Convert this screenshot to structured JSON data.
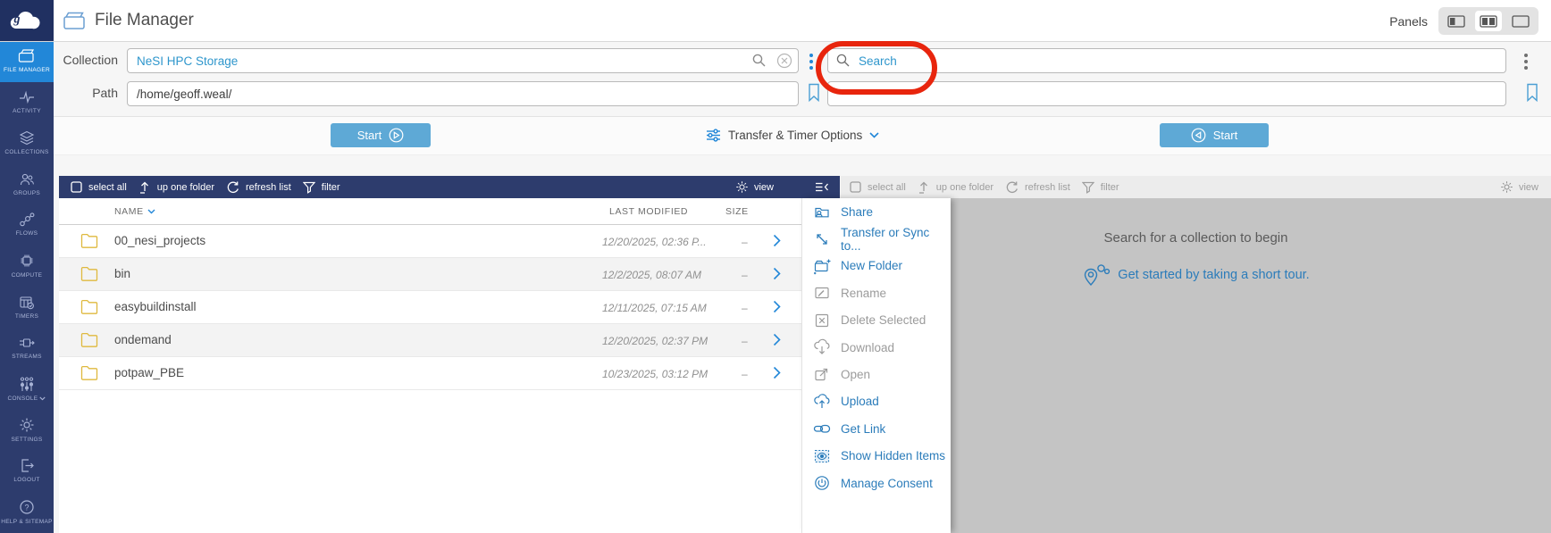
{
  "topbar": {
    "title": "File Manager",
    "panels_label": "Panels"
  },
  "sidebar": {
    "items": [
      {
        "label": "FILE MANAGER"
      },
      {
        "label": "ACTIVITY"
      },
      {
        "label": "COLLECTIONS"
      },
      {
        "label": "GROUPS"
      },
      {
        "label": "FLOWS"
      },
      {
        "label": "COMPUTE"
      },
      {
        "label": "TIMERS"
      },
      {
        "label": "STREAMS"
      },
      {
        "label": "CONSOLE"
      },
      {
        "label": "SETTINGS"
      },
      {
        "label": "LOGOUT"
      },
      {
        "label": "HELP & SITEMAP"
      }
    ]
  },
  "collection_form": {
    "collection_label": "Collection",
    "collection_value": "NeSI HPC Storage",
    "path_label": "Path",
    "path_value": "/home/geoff.weal/",
    "search_placeholder": "Search"
  },
  "transfer_bar": {
    "start_left": "Start",
    "options_label": "Transfer & Timer Options",
    "start_right": "Start"
  },
  "toolbar": {
    "select_all": "select all",
    "up_one_folder": "up one folder",
    "refresh_list": "refresh list",
    "filter": "filter",
    "view": "view"
  },
  "table": {
    "headers": {
      "name": "NAME",
      "last_modified": "LAST MODIFIED",
      "size": "SIZE"
    },
    "rows": [
      {
        "name": "00_nesi_projects",
        "modified": "12/20/2025, 02:36 P...",
        "size": "–"
      },
      {
        "name": "bin",
        "modified": "12/2/2025, 08:07 AM",
        "size": "–"
      },
      {
        "name": "easybuildinstall",
        "modified": "12/11/2025, 07:15 AM",
        "size": "–"
      },
      {
        "name": "ondemand",
        "modified": "12/20/2025, 02:37 PM",
        "size": "–"
      },
      {
        "name": "potpaw_PBE",
        "modified": "10/23/2025, 03:12 PM",
        "size": "–"
      }
    ]
  },
  "context_menu": {
    "items": [
      {
        "label": "Share",
        "enabled": true
      },
      {
        "label": "Transfer or Sync to...",
        "enabled": true
      },
      {
        "label": "New Folder",
        "enabled": true
      },
      {
        "label": "Rename",
        "enabled": false
      },
      {
        "label": "Delete Selected",
        "enabled": false
      },
      {
        "label": "Download",
        "enabled": false
      },
      {
        "label": "Open",
        "enabled": false
      },
      {
        "label": "Upload",
        "enabled": true
      },
      {
        "label": "Get Link",
        "enabled": true
      },
      {
        "label": "Show Hidden Items",
        "enabled": true
      },
      {
        "label": "Manage Consent",
        "enabled": true
      }
    ]
  },
  "right_panel": {
    "empty_title": "Search for a collection to begin",
    "tour_link": "Get started by taking a short tour."
  },
  "colors": {
    "navy": "#2d3c6d",
    "active_blue": "#2287d8",
    "button_blue": "#5ea9d6",
    "link_blue": "#2b7cba",
    "annotation_red": "#e8250d",
    "folder_yellow": "#dfb93e",
    "panel_grey": "#c4c4c4"
  }
}
